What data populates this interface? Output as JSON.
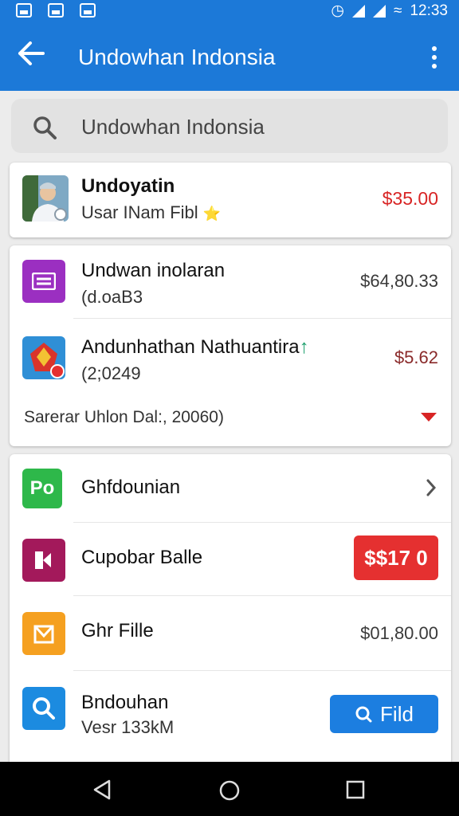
{
  "status_bar": {
    "time": "12:33",
    "battery": "≈"
  },
  "app_bar": {
    "title": "Undowhan Indonsia"
  },
  "search": {
    "text": "Undowhan Indonsia"
  },
  "card1": {
    "name": "Undoyatin",
    "subtitle": "Usar INam Fibl",
    "star": "⭐",
    "amount": "$35.00"
  },
  "card2": {
    "item1": {
      "title": "Undwan inolaran",
      "sub": "(d.oaB3",
      "amount": "$64,80.33"
    },
    "item2": {
      "title": "Andunhathan Nathuantira",
      "arrow": "↑",
      "sub": "(2;0249",
      "amount": "$5.62"
    },
    "footer": "Sarerar Uhlon Dal:, 20060)"
  },
  "card3": {
    "item1": {
      "title": "Ghfdounian",
      "icon_text": "Po"
    },
    "item2": {
      "title": "Cupobar Balle",
      "amount": "$$17 0"
    },
    "item3": {
      "title": "Ghr Fille",
      "amount": "$01,80.00"
    },
    "item4": {
      "title": "Bndouhan",
      "sub": "Vesr 133kM",
      "button": "Fild"
    }
  },
  "colors": {
    "primary": "#1c79d8",
    "danger": "#e53030",
    "price_red": "#d82424"
  }
}
